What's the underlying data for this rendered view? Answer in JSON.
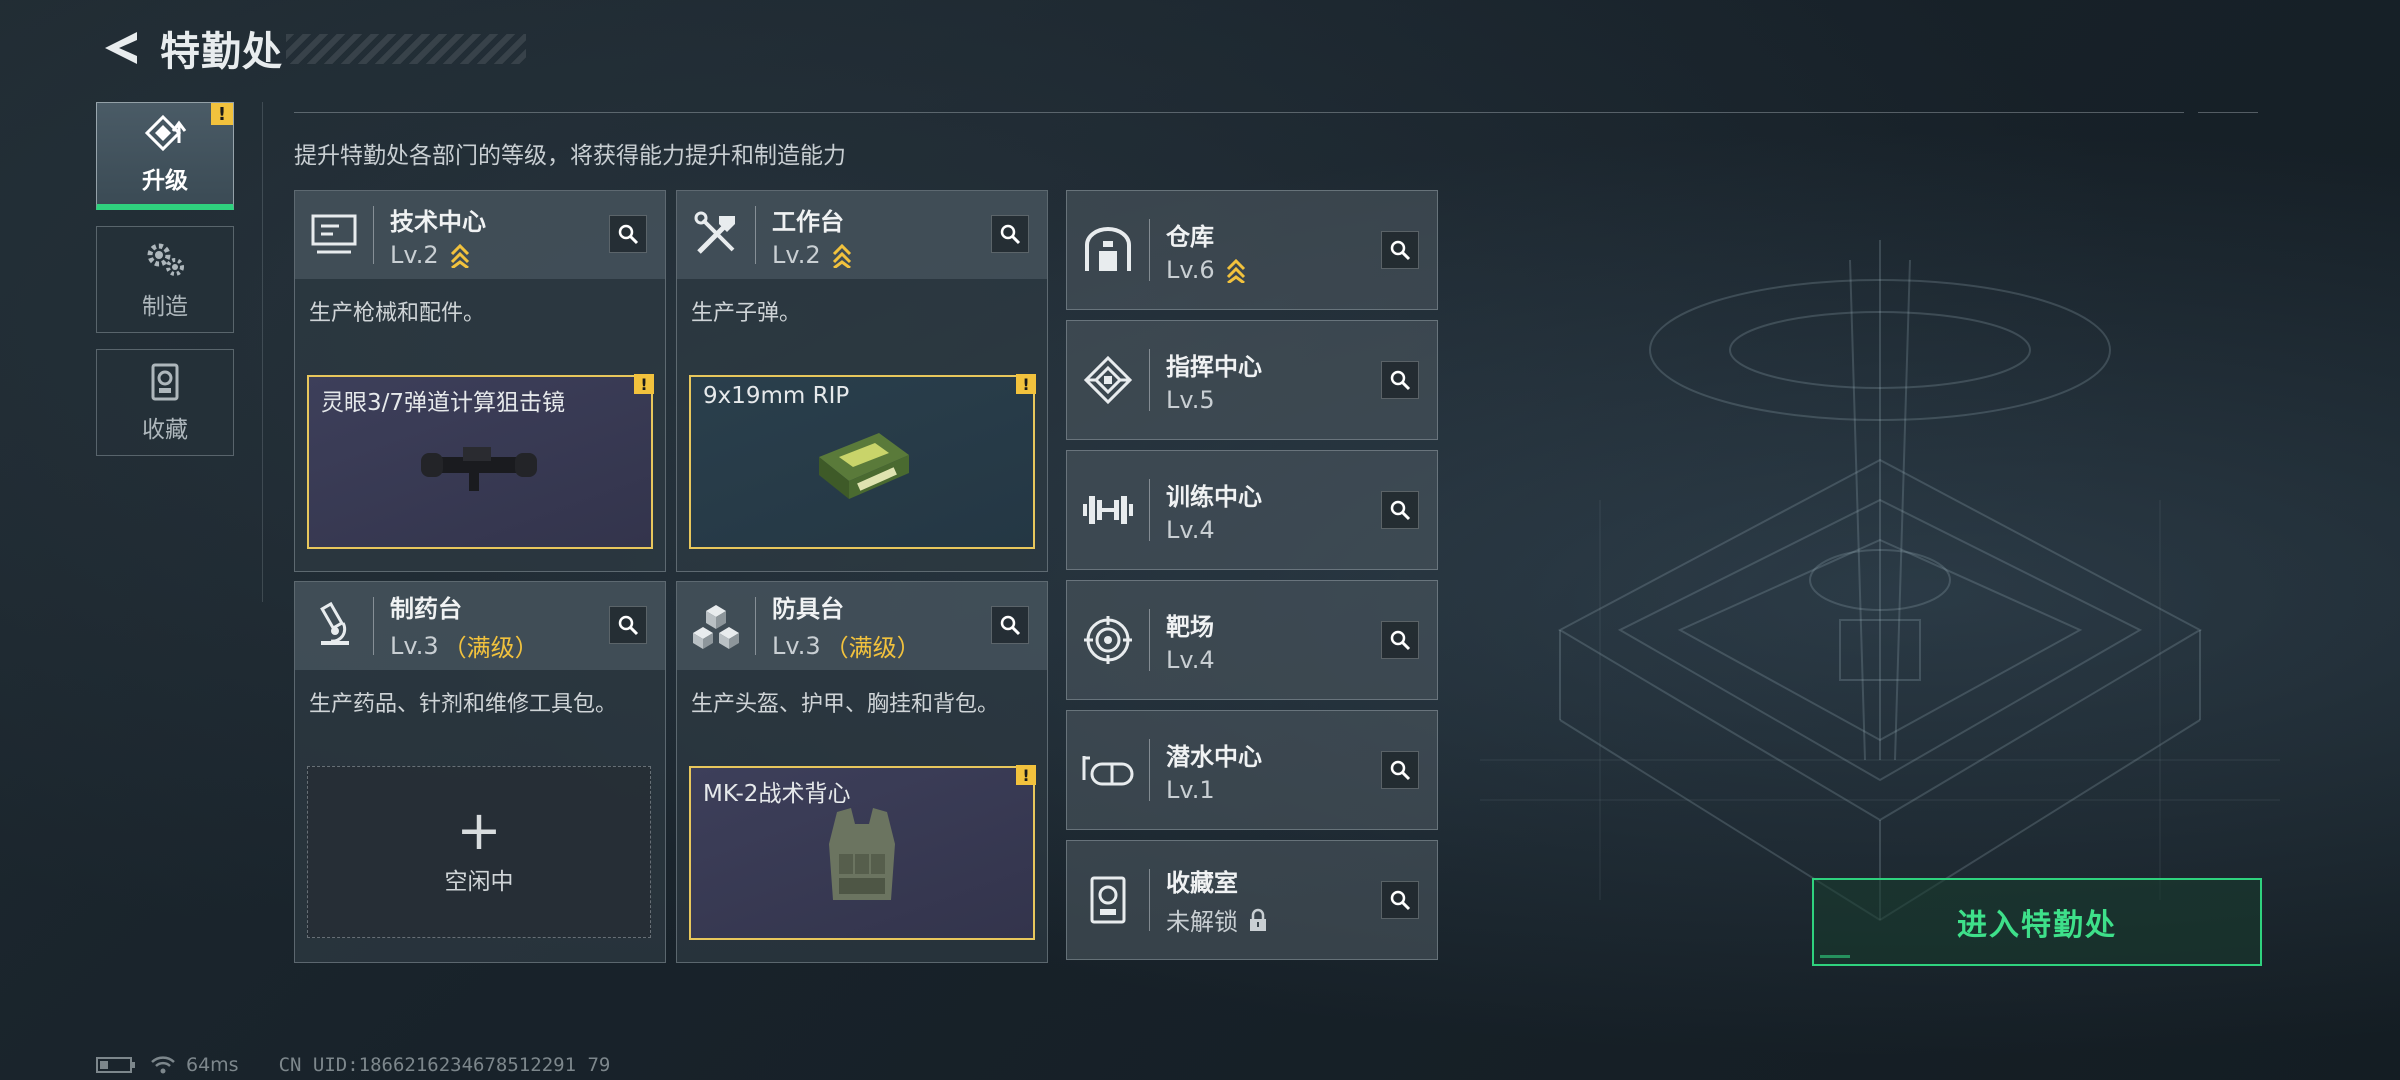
{
  "header": {
    "title": "特勤处"
  },
  "sidenav": {
    "items": [
      {
        "label": "升级",
        "icon": "upgrade-icon",
        "warning": "!"
      },
      {
        "label": "制造",
        "icon": "gears-icon"
      },
      {
        "label": "收藏",
        "icon": "trophy-icon"
      }
    ]
  },
  "subtitle": "提升特勤处各部门的等级，将获得能力提升和制造能力",
  "cards": [
    {
      "name": "技术中心",
      "level": "Lv.2",
      "desc": "生产枪械和配件。",
      "slot": {
        "name": "灵眼3/7弹道计算狙击镜",
        "warning": "!"
      }
    },
    {
      "name": "工作台",
      "level": "Lv.2",
      "desc": "生产子弹。",
      "slot": {
        "name": "9x19mm RIP",
        "warning": "!"
      }
    },
    {
      "name": "制药台",
      "level": "Lv.3",
      "level_note": "（满级）",
      "desc": "生产药品、针剂和维修工具包。",
      "slot": {
        "plus": "+",
        "idle": "空闲中"
      }
    },
    {
      "name": "防具台",
      "level": "Lv.3",
      "level_note": "（满级）",
      "desc": "生产头盔、护甲、胸挂和背包。",
      "slot": {
        "name": "MK-2战术背心",
        "warning": "!"
      }
    }
  ],
  "small_cards": [
    {
      "name": "仓库",
      "level": "Lv.6"
    },
    {
      "name": "指挥中心",
      "level": "Lv.5"
    },
    {
      "name": "训练中心",
      "level": "Lv.4"
    },
    {
      "name": "靶场",
      "level": "Lv.4"
    },
    {
      "name": "潜水中心",
      "level": "Lv.1"
    },
    {
      "name": "收藏室",
      "level": "未解锁"
    }
  ],
  "enter_button": "进入特勤处",
  "status": {
    "ping": "64ms",
    "uid": "CN UID:1866216234678512291 79"
  },
  "colors": {
    "accent": "#2fd27e",
    "warning": "#f2c23d",
    "slot_border": "#e8c75c"
  }
}
